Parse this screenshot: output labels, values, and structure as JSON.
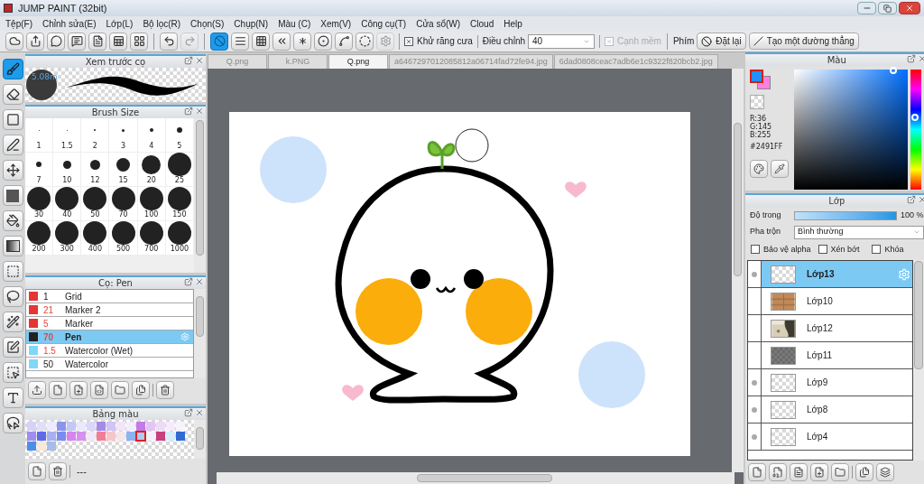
{
  "window": {
    "title": "JUMP PAINT (32bit)"
  },
  "menu": [
    "Tệp(F)",
    "Chỉnh sửa(E)",
    "Lớp(L)",
    "Bộ lọc(R)",
    "Chọn(S)",
    "Chụp(N)",
    "Màu (C)",
    "Xem(V)",
    "Công cụ(T)",
    "Cửa sổ(W)",
    "Cloud",
    "Help"
  ],
  "toolbar": {
    "buttons": [
      {
        "selected": false,
        "disabled": false
      },
      {
        "selected": false,
        "disabled": false
      },
      {
        "selected": false,
        "disabled": false
      },
      {
        "selected": false,
        "disabled": false
      },
      {
        "selected": false,
        "disabled": false
      },
      {
        "selected": false,
        "disabled": false
      },
      {
        "selected": false,
        "disabled": false
      },
      {
        "selected": false,
        "disabled": false
      },
      {
        "selected": false,
        "disabled": true
      },
      {
        "selected": true,
        "disabled": false
      },
      {
        "selected": false,
        "disabled": false
      },
      {
        "selected": false,
        "disabled": false
      },
      {
        "selected": false,
        "disabled": false
      },
      {
        "selected": false,
        "disabled": false
      },
      {
        "selected": false,
        "disabled": false
      },
      {
        "selected": false,
        "disabled": false
      },
      {
        "selected": false,
        "disabled": false
      },
      {
        "selected": false,
        "disabled": true
      }
    ],
    "antialias": {
      "label": "Khử răng cưa",
      "checked": true
    },
    "adjust": {
      "label": "Điều chỉnh",
      "value": "40"
    },
    "soft_edge": {
      "label": "Cạnh mềm",
      "checked": true,
      "disabled": true
    },
    "keys_label": "Phím",
    "reset_button": "Đặt lại",
    "line_button": "Tạo một đường thẳng"
  },
  "tools": [
    {
      "selected": true
    },
    {
      "selected": false
    },
    {
      "selected": false
    },
    {
      "selected": false
    },
    {
      "selected": false
    },
    {
      "selected": false
    },
    {
      "selected": false
    },
    {
      "selected": false
    },
    {
      "selected": false
    },
    {
      "selected": false
    },
    {
      "selected": false
    },
    {
      "selected": false
    },
    {
      "selected": false
    },
    {
      "selected": false
    },
    {
      "selected": false
    }
  ],
  "brush_preview": {
    "title": "Xem trước cọ",
    "size": "5.08m"
  },
  "brush_size": {
    "title": "Brush Size",
    "sizes": [
      "1",
      "1.5",
      "2",
      "3",
      "4",
      "5",
      "7",
      "10",
      "12",
      "15",
      "20",
      "25",
      "30",
      "40",
      "50",
      "70",
      "100",
      "150",
      "200",
      "300",
      "400",
      "500",
      "700",
      "1000"
    ]
  },
  "brushes": {
    "title": "Cọ: Pen",
    "items": [
      {
        "color": "#e53535",
        "size": "1",
        "name": "Grid",
        "modified": false,
        "selected": false
      },
      {
        "color": "#e53535",
        "size": "21",
        "name": "Marker 2",
        "modified": true,
        "selected": false
      },
      {
        "color": "#e53535",
        "size": "5",
        "name": "Marker",
        "modified": true,
        "selected": false
      },
      {
        "color": "#222222",
        "size": "70",
        "name": "Pen",
        "modified": true,
        "selected": true
      },
      {
        "color": "#7fd8f5",
        "size": "1.5",
        "name": "Watercolor (Wet)",
        "modified": true,
        "selected": false
      },
      {
        "color": "#7fd8f5",
        "size": "50",
        "name": "Watercolor",
        "modified": false,
        "selected": false
      }
    ]
  },
  "palette": {
    "title": "Bảng màu",
    "status": "---",
    "colors": [
      {
        "color": "#d6d2f7",
        "selected": false
      },
      {
        "color": "#e2defa",
        "selected": false
      },
      {
        "color": "#eeeaff",
        "selected": false
      },
      {
        "color": "#8a96ee",
        "selected": false
      },
      {
        "color": "#c2c8f5",
        "selected": false
      },
      {
        "color": "#ebe8fc",
        "selected": false
      },
      {
        "color": "#dcd6fa",
        "selected": false
      },
      {
        "color": "#a68ae8",
        "selected": false
      },
      {
        "color": "#d2c4f4",
        "selected": false
      },
      {
        "color": "#f3e4f8",
        "selected": false
      },
      {
        "color": "#f1eefd",
        "selected": false
      },
      {
        "color": "#c07ce8",
        "selected": false
      },
      {
        "color": "#e4c4f2",
        "selected": false
      },
      {
        "color": "#eedcf7",
        "selected": false
      },
      {
        "color": "#f4ecfb",
        "selected": false
      },
      {
        "color": "#f7f3fd",
        "selected": false
      },
      {
        "color": "#9e8ef0",
        "selected": false
      },
      {
        "color": "#5f6ae8",
        "selected": false
      },
      {
        "color": "#a8b0f2",
        "selected": false
      },
      {
        "color": "#7b8cf0",
        "selected": false
      },
      {
        "color": "#d685ee",
        "selected": false
      },
      {
        "color": "#d791ee",
        "selected": false
      },
      {
        "color": "#f3e9f6",
        "selected": false
      },
      {
        "color": "#f07f96",
        "selected": false
      },
      {
        "color": "#f7c6cd",
        "selected": false
      },
      {
        "color": "#f5e8ec",
        "selected": false
      },
      {
        "color": "#8fb2f0",
        "selected": false
      },
      {
        "color": "#a9cdf5",
        "selected": true
      },
      {
        "color": "#f5f1fa",
        "selected": false
      },
      {
        "color": "#c8407e",
        "selected": false
      },
      {
        "color": "#d6edfa",
        "selected": false
      },
      {
        "color": "#2f6bd0",
        "selected": false
      },
      {
        "color": "#4f8ee6",
        "selected": false
      },
      {
        "color": "#fae8d8",
        "selected": false
      },
      {
        "color": "#a8bce8",
        "selected": false
      }
    ]
  },
  "tabs": [
    {
      "label": "Q.png",
      "selected": false
    },
    {
      "label": "k.PNG",
      "selected": false
    },
    {
      "label": "Q.png",
      "selected": true
    },
    {
      "label": "a6467297012085812a06714fad72fe94.jpg",
      "selected": false
    },
    {
      "label": "6dad0808ceac7adb6e1c9322f820bcb2.jpg",
      "selected": false
    }
  ],
  "color_panel": {
    "title": "Màu",
    "r": "R:36",
    "g": "G:145",
    "b": "B:255",
    "hex": "#2491FF"
  },
  "layer_panel": {
    "title": "Lớp",
    "opacity_label": "Độ trong",
    "opacity": {
      "level": 1
    },
    "opacity_value": "100 %",
    "blend_label": "Pha trộn",
    "blend_value": "Bình thường",
    "options": [
      {
        "label": "Bảo vệ alpha",
        "checked": false
      },
      {
        "label": "Xén bớt",
        "checked": false
      },
      {
        "label": "Khóa",
        "checked": false
      }
    ],
    "layers": [
      {
        "name": "Lớp13",
        "kind": "empty",
        "visible": true,
        "selected": true
      },
      {
        "name": "Lớp10",
        "kind": "wood",
        "visible": false,
        "selected": false
      },
      {
        "name": "Lớp12",
        "visible": false,
        "selected": false
      },
      {
        "name": "Lớp11",
        "kind": "dark",
        "visible": false,
        "selected": false
      },
      {
        "name": "Lớp9",
        "kind": "empty",
        "visible": true,
        "selected": false
      },
      {
        "name": "Lớp8",
        "kind": "empty",
        "visible": true,
        "selected": false
      },
      {
        "name": "Lớp4",
        "kind": "empty",
        "visible": true,
        "selected": false
      }
    ]
  }
}
